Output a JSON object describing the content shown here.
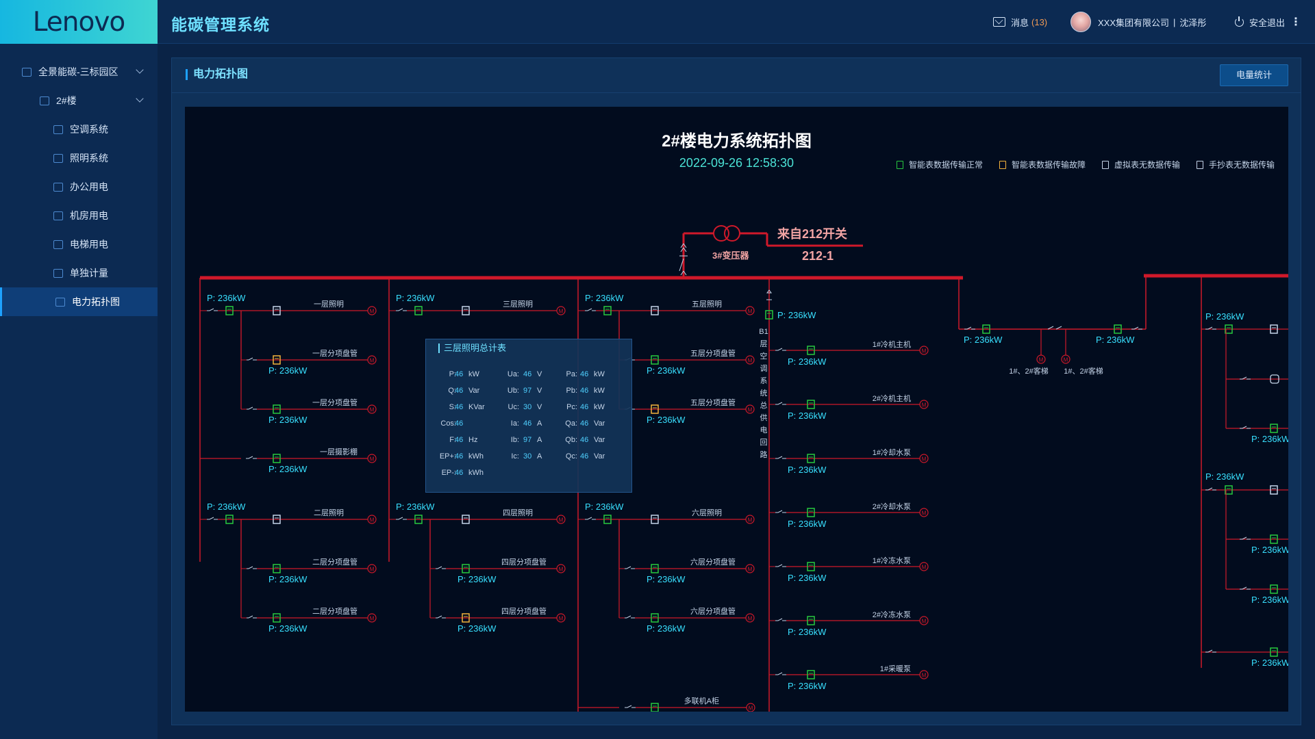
{
  "header": {
    "logo": "Lenovo",
    "title": "能碳管理系统",
    "msg_label": "消息",
    "msg_count": "(13)",
    "company": "XXX集团有限公司",
    "separator": "|",
    "user": "沈泽彤",
    "logout": "安全退出",
    "more": "⋮"
  },
  "sidebar": {
    "items": [
      {
        "label": "全景能碳-三标园区",
        "level": 0,
        "expand": true
      },
      {
        "label": "2#楼",
        "level": 1,
        "expand": true
      },
      {
        "label": "空调系统",
        "level": 2
      },
      {
        "label": "照明系统",
        "level": 2
      },
      {
        "label": "办公用电",
        "level": 2
      },
      {
        "label": "机房用电",
        "level": 2
      },
      {
        "label": "电梯用电",
        "level": 2
      },
      {
        "label": "单独计量",
        "level": 2
      },
      {
        "label": "电力拓扑图",
        "level": 2,
        "active": true
      }
    ]
  },
  "panel": {
    "title": "电力拓扑图",
    "button": "电量统计"
  },
  "diagram": {
    "title": "2#楼电力系统拓扑图",
    "time": "2022-09-26   12:58:30",
    "legend": [
      {
        "label": "智能表数据传输正常",
        "color": "#27c93f"
      },
      {
        "label": "智能表数据传输故障",
        "color": "#f5b43b"
      },
      {
        "label": "虚拟表无数据传输",
        "color": "#c5d4e8"
      },
      {
        "label": "手抄表无数据传输",
        "color": "#c5d4e8"
      }
    ],
    "source": "来自212开关",
    "source_no": "212-1",
    "transformer": "3#变压器",
    "power": "P: 236kW",
    "b1_vertical": [
      "B1",
      "层",
      "空",
      "调",
      "系",
      "统",
      "总",
      "供",
      "电",
      "回",
      "路"
    ],
    "col1": [
      "一层照明",
      "一层分项盘管",
      "一层分项盘管",
      "一层摄影棚",
      "二层照明",
      "二层分项盘管",
      "二层分项盘管"
    ],
    "col2": [
      "三层照明",
      "四层照明",
      "四层分项盘管",
      "四层分项盘管"
    ],
    "col3": [
      "五层照明",
      "五层分项盘管",
      "五层分项盘管",
      "六层照明",
      "六层分项盘管",
      "六层分项盘管",
      "多联机A柜"
    ],
    "col4": [
      "1#冷机主机",
      "2#冷机主机",
      "1#冷却水泵",
      "2#冷却水泵",
      "1#冷冻水泵",
      "2#冷冻水泵",
      "1#采暖泵"
    ],
    "elevators": [
      "1#、2#客梯",
      "1#、2#客梯"
    ],
    "motor": "M"
  },
  "tooltip": {
    "title": "三层照明总计表",
    "col1": [
      [
        "P:",
        "46",
        "kW"
      ],
      [
        "Q:",
        "46",
        "Var"
      ],
      [
        "S:",
        "46",
        "KVar"
      ],
      [
        "Cos:",
        "46",
        ""
      ],
      [
        "F:",
        "46",
        "Hz"
      ],
      [
        "EP+:",
        "46",
        "kWh"
      ],
      [
        "EP-:",
        "46",
        "kWh"
      ]
    ],
    "col2": [
      [
        "Ua:",
        "46",
        "V"
      ],
      [
        "Ub:",
        "97",
        "V"
      ],
      [
        "Uc:",
        "30",
        "V"
      ],
      [
        "Ia:",
        "46",
        "A"
      ],
      [
        "Ib:",
        "97",
        "A"
      ],
      [
        "Ic:",
        "30",
        "A"
      ]
    ],
    "col3": [
      [
        "Pa:",
        "46",
        "kW"
      ],
      [
        "Pb:",
        "46",
        "kW"
      ],
      [
        "Pc:",
        "46",
        "kW"
      ],
      [
        "Qa:",
        "46",
        "Var"
      ],
      [
        "Qb:",
        "46",
        "Var"
      ],
      [
        "Qc:",
        "46",
        "Var"
      ]
    ]
  }
}
